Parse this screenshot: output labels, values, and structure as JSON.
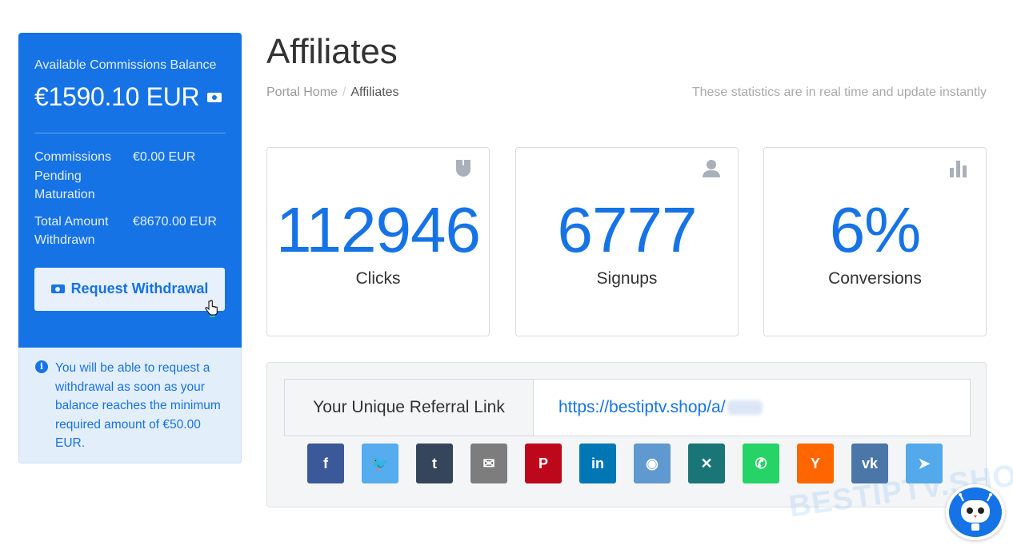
{
  "sidebar": {
    "balance_label": "Available Commissions Balance",
    "balance_amount": "€1590.10 EUR",
    "stats": [
      {
        "label": "Commissions Pending Maturation",
        "value": "€0.00 EUR"
      },
      {
        "label": "Total Amount Withdrawn",
        "value": "€8670.00 EUR"
      }
    ],
    "withdraw_button": "Request Withdrawal",
    "info_text": "You will be able to request a withdrawal as soon as your balance reaches the minimum required amount of €50.00 EUR."
  },
  "header": {
    "title": "Affiliates",
    "breadcrumb": [
      "Portal Home",
      "Affiliates"
    ],
    "note": "These statistics are in real time and update instantly"
  },
  "stats": [
    {
      "value": "112946",
      "label": "Clicks",
      "icon": "mouse-icon"
    },
    {
      "value": "6777",
      "label": "Signups",
      "icon": "user-icon"
    },
    {
      "value": "6%",
      "label": "Conversions",
      "icon": "bar-chart-icon"
    }
  ],
  "referral": {
    "label": "Your Unique Referral Link",
    "link": "https://bestiptv.shop/a/"
  },
  "share": [
    {
      "name": "facebook",
      "glyph": "f",
      "color": "#3b5998"
    },
    {
      "name": "twitter",
      "glyph": "🐦",
      "color": "#55acee"
    },
    {
      "name": "tumblr",
      "glyph": "t",
      "color": "#35465c"
    },
    {
      "name": "email",
      "glyph": "✉",
      "color": "#7d7d7d"
    },
    {
      "name": "pinterest",
      "glyph": "P",
      "color": "#bd081c"
    },
    {
      "name": "linkedin",
      "glyph": "in",
      "color": "#0077b5"
    },
    {
      "name": "reddit",
      "glyph": "◉",
      "color": "#5f99cf"
    },
    {
      "name": "xing",
      "glyph": "✕",
      "color": "#1a7576"
    },
    {
      "name": "whatsapp",
      "glyph": "✆",
      "color": "#25d366"
    },
    {
      "name": "hackernews",
      "glyph": "Y",
      "color": "#ff6600"
    },
    {
      "name": "vk",
      "glyph": "vk",
      "color": "#4a76a8"
    },
    {
      "name": "telegram",
      "glyph": "➤",
      "color": "#54a9eb"
    }
  ],
  "watermark": "BESTIPTV.SHOP",
  "colors": {
    "primary": "#1673e6",
    "info_bg": "#e3eefb",
    "panel_bg": "#f4f5f7"
  }
}
